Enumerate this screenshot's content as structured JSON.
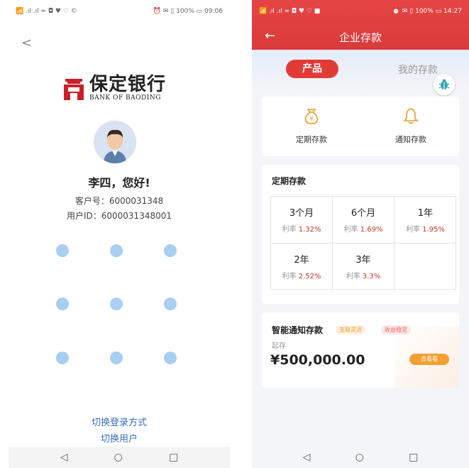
{
  "left": {
    "status_left": "📶 .ıl .ıl ≈ ◘ ♥ ♡ ©",
    "status_right": "⏰ ✉ ▯ 100% ▭ 09:06",
    "back": "<",
    "logo": {
      "cn": "保定银行",
      "en": "BANK OF BAODING"
    },
    "greeting": "李四，您好!",
    "customer_no": "客户号：6000031348",
    "user_id": "用户ID：6000031348001",
    "switch_login": "切换登录方式",
    "switch_user": "切换用户",
    "nav": {
      "back": "◁",
      "home": "○",
      "recent": "□"
    }
  },
  "right": {
    "status_left": "📶 .ıl .ıl ≈ ◘ ♥ ♡ ■",
    "status_right": "⏰ ✉ ▯ 100% ▭ 14:27",
    "back": "←",
    "title": "企业存款",
    "tabs": {
      "active": "产品",
      "inactive": "我的存款"
    },
    "products": [
      {
        "icon": "money-bag-icon",
        "label": "定期存款"
      },
      {
        "icon": "bell-icon",
        "label": "通知存款"
      }
    ],
    "fixed_section_title": "定期存款",
    "rate_prefix": "利率",
    "terms": [
      {
        "term": "3个月",
        "rate": "1.32%"
      },
      {
        "term": "6个月",
        "rate": "1.69%"
      },
      {
        "term": "1年",
        "rate": "1.95%"
      },
      {
        "term": "2年",
        "rate": "2.52%"
      },
      {
        "term": "3年",
        "rate": "3.3%"
      }
    ],
    "smart": {
      "title": "智能通知存款",
      "tag1": "支取灵活",
      "tag2": "收益稳定",
      "start_label": "起存",
      "amount": "¥500,000.00",
      "button": "去看看"
    },
    "nav": {
      "back": "◁",
      "home": "○",
      "recent": "□"
    }
  },
  "colors": {
    "brand_red": "#e23b35",
    "dot_blue": "#a8cff2",
    "link_blue": "#3a6fb8",
    "rate_red": "#c0392b",
    "orange": "#f2a032"
  }
}
